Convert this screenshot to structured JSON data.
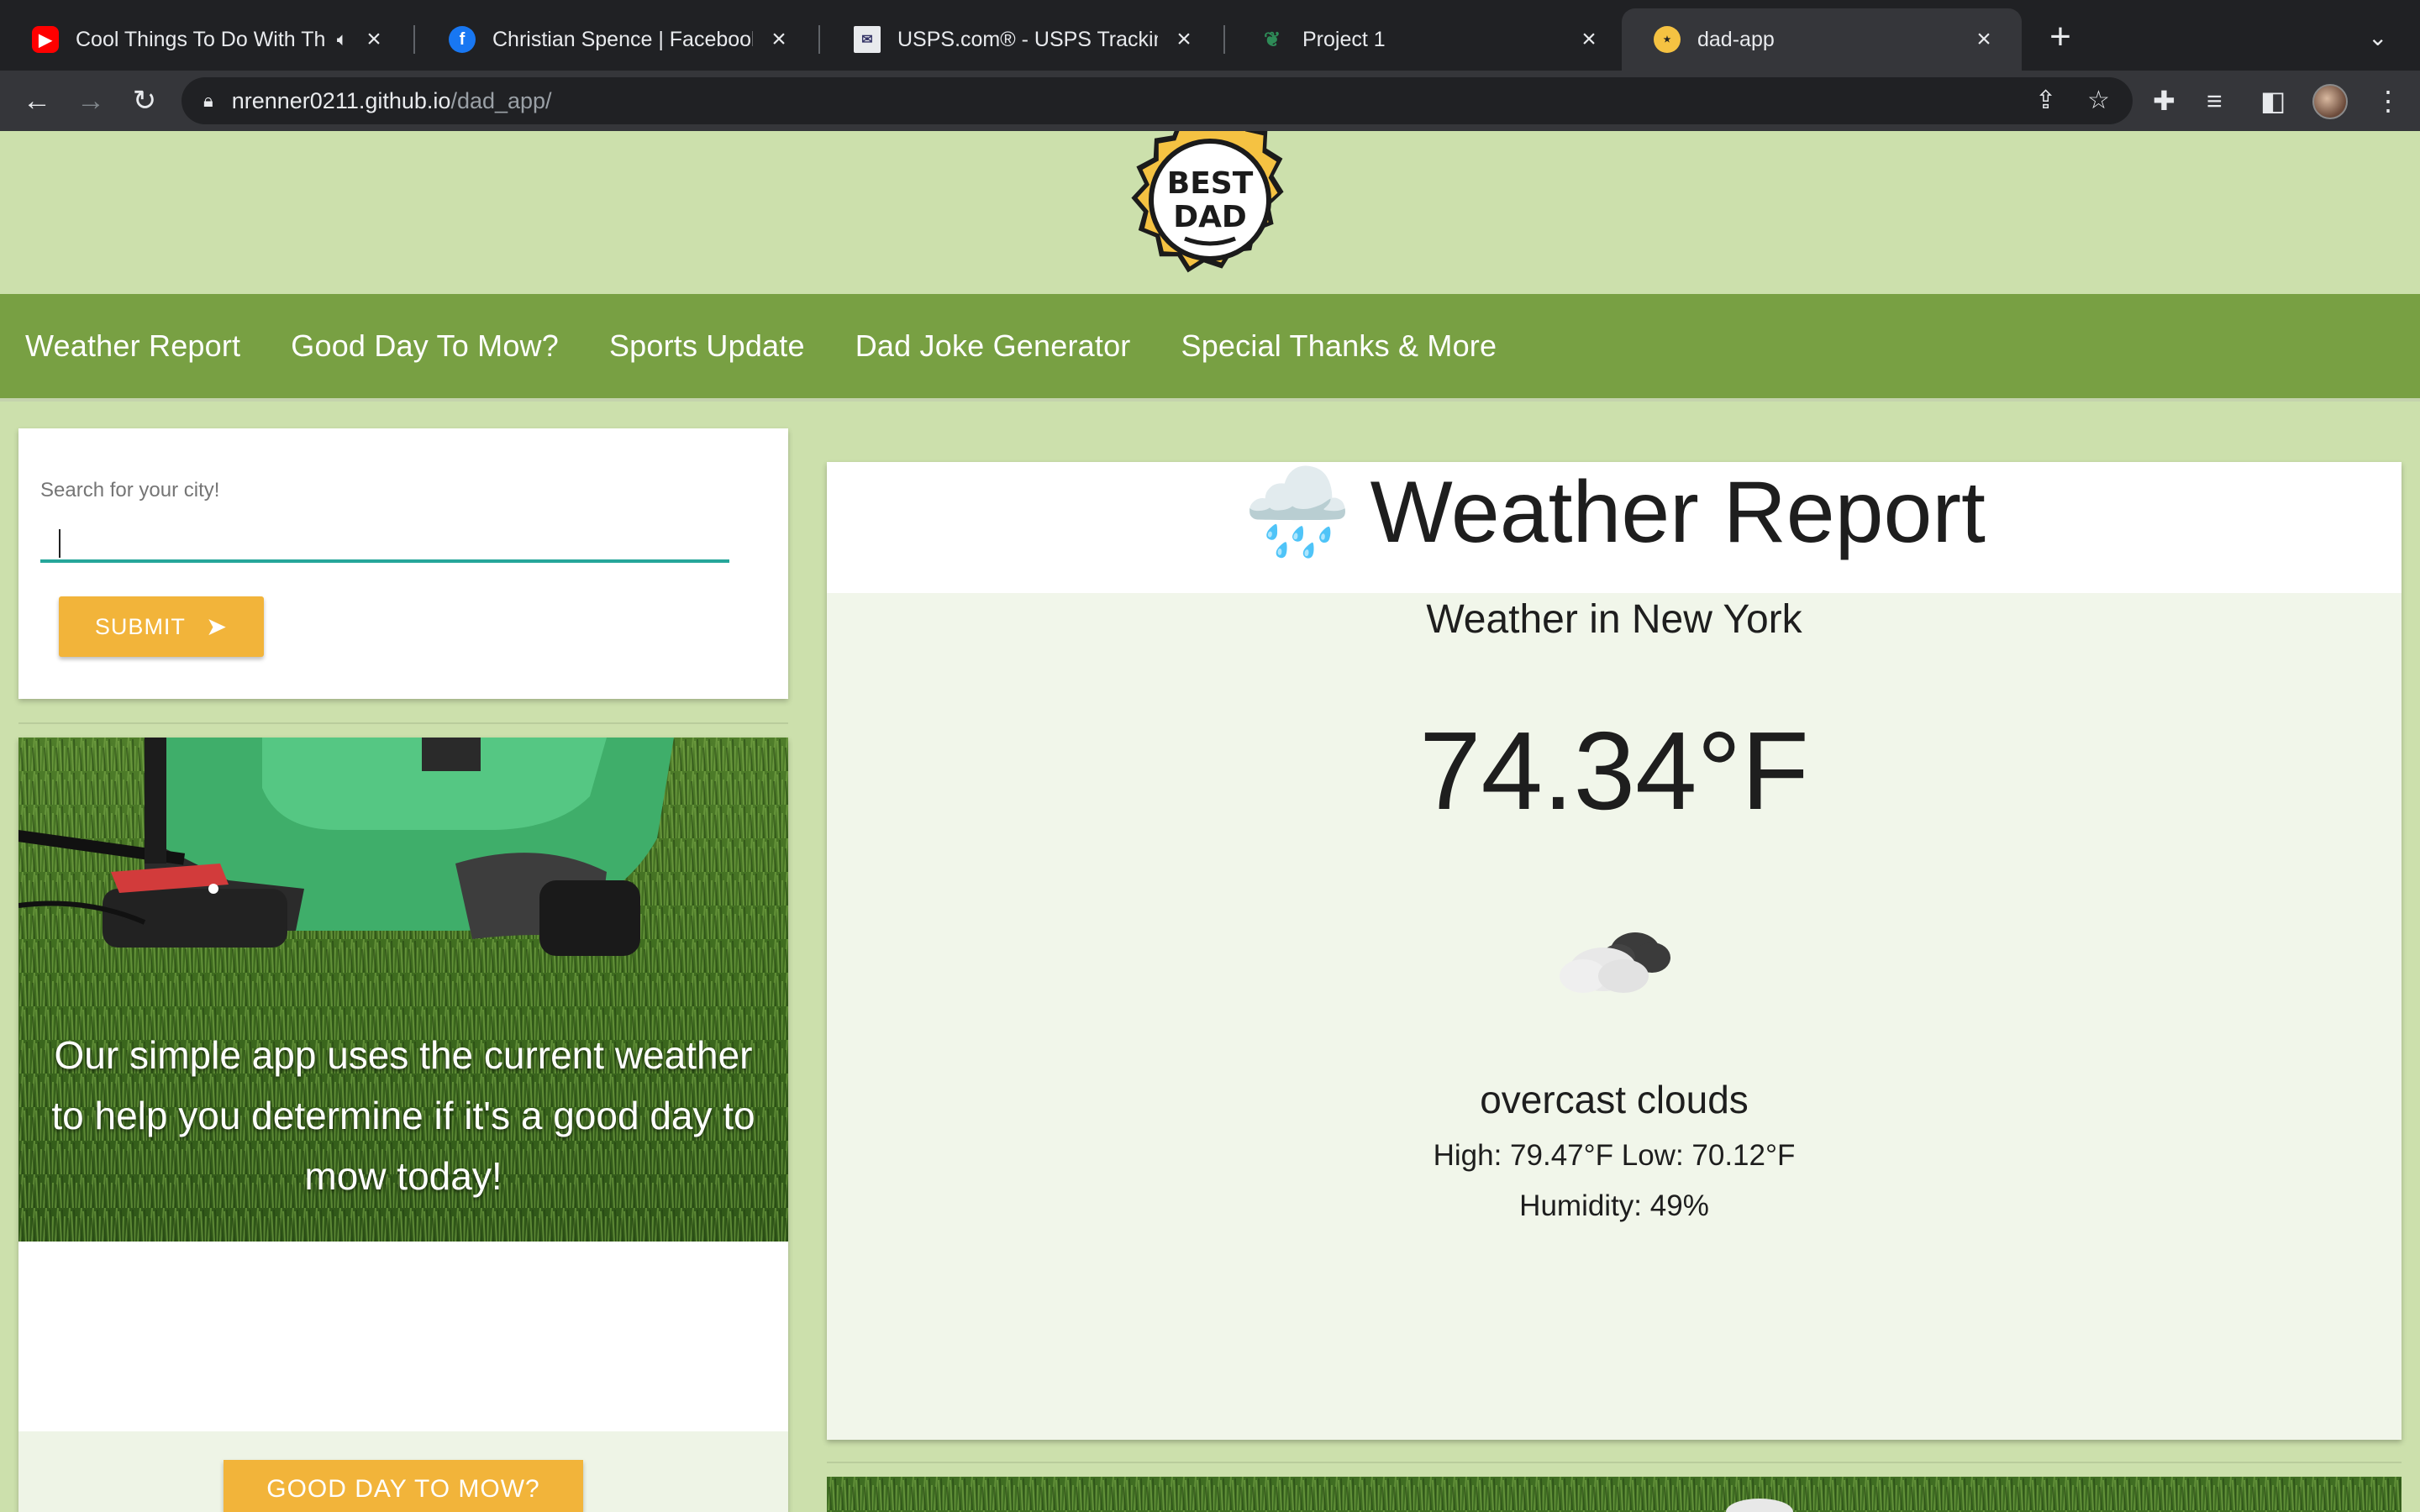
{
  "browser": {
    "tabs": [
      {
        "title": "Cool Things To Do With Th",
        "favicon": "youtube-icon",
        "muted": true
      },
      {
        "title": "Christian Spence | Facebook",
        "favicon": "facebook-icon"
      },
      {
        "title": "USPS.com® - USPS Tracking®",
        "favicon": "usps-icon"
      },
      {
        "title": "Project 1",
        "favicon": "leaf-icon"
      },
      {
        "title": "dad-app",
        "favicon": "best-dad-icon",
        "active": true
      }
    ],
    "url_host": "nrenner0211.github.io",
    "url_path": "/dad_app/"
  },
  "logo": {
    "line1": "BEST",
    "line2": "DAD"
  },
  "nav": {
    "items": [
      "Weather Report",
      "Good Day To Mow?",
      "Sports Update",
      "Dad Joke Generator",
      "Special Thanks & More"
    ]
  },
  "search": {
    "label": "Search for your city!",
    "value": "",
    "submit_label": "SUBMIT"
  },
  "mow": {
    "description": "Our simple app uses the current weather to help you determine if it's a good day to mow today!",
    "button_label": "GOOD DAY TO MOW?"
  },
  "weather": {
    "title": "Weather Report",
    "title_emoji": "🌧️",
    "city_line": "Weather in New York",
    "temperature": "74.34°F",
    "icon": "overcast-clouds-icon",
    "description": "overcast clouds",
    "high_low": "High: 79.47°F Low: 70.12°F",
    "humidity": "Humidity: 49%"
  },
  "colors": {
    "page_bg": "#cce0ac",
    "navbar": "#78a043",
    "accent_button": "#f2b43a",
    "input_underline": "#26a69a"
  }
}
